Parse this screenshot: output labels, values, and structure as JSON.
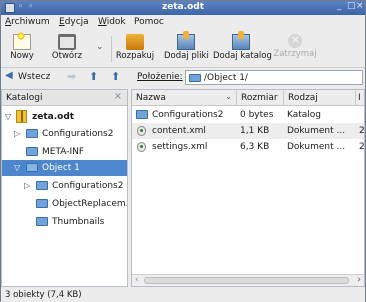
{
  "window": {
    "title": "zeta.odt",
    "controls": [
      "_",
      "□",
      "×"
    ]
  },
  "menu": [
    {
      "label": "Archiwum",
      "u": "A",
      "rest": "rchiwum"
    },
    {
      "label": "Edycja",
      "u": "E",
      "rest": "dycja"
    },
    {
      "label": "Widok",
      "u": "W",
      "rest": "idok"
    },
    {
      "label": "Pomoc",
      "u": "",
      "rest": "Pomoc"
    }
  ],
  "toolbar": {
    "new": "Nowy",
    "open": "Otwórz",
    "open_arrow": "⌄",
    "unpack": "Rozpakuj",
    "add_files": "Dodaj pliki",
    "add_folder": "Dodaj katalog",
    "stop": "Zatrzymaj"
  },
  "location": {
    "back": "Wstecz",
    "back_arrow": "◀",
    "forward_arrow": "➡",
    "up_arrow": "⬆",
    "home_arrow": "⬆",
    "label": "Położenie:",
    "path": "/Object 1/"
  },
  "sidebar": {
    "title": "Katalogi",
    "close": "⨯",
    "items": [
      {
        "label": "zeta.odt",
        "arrow": "▽"
      },
      {
        "label": "Configurations2",
        "arrow": "▷"
      },
      {
        "label": "META-INF",
        "arrow": ""
      },
      {
        "label": "Object 1",
        "arrow": "▽"
      },
      {
        "label": "Configurations2",
        "arrow": "▷"
      },
      {
        "label": "ObjectReplacem...",
        "arrow": ""
      },
      {
        "label": "Thumbnails",
        "arrow": ""
      }
    ]
  },
  "files": {
    "columns": [
      "Nazwa",
      "Rozmiar",
      "Rodzaj",
      "I"
    ],
    "sort_indicator": "⌄",
    "rows": [
      {
        "name": "Configurations2",
        "size": "0 bytes",
        "type": "Katalog",
        "extra": ""
      },
      {
        "name": "content.xml",
        "size": "1,1 KB",
        "type": "Dokument ...",
        "extra": "2"
      },
      {
        "name": "settings.xml",
        "size": "6,3 KB",
        "type": "Dokument ...",
        "extra": "2"
      }
    ],
    "scroll_left": "‹",
    "scroll_right": "›"
  },
  "status": "3 obiekty (7,4 KB)",
  "colors": {
    "selection": "#4d86cc",
    "titlebar": "#3c64a8"
  }
}
